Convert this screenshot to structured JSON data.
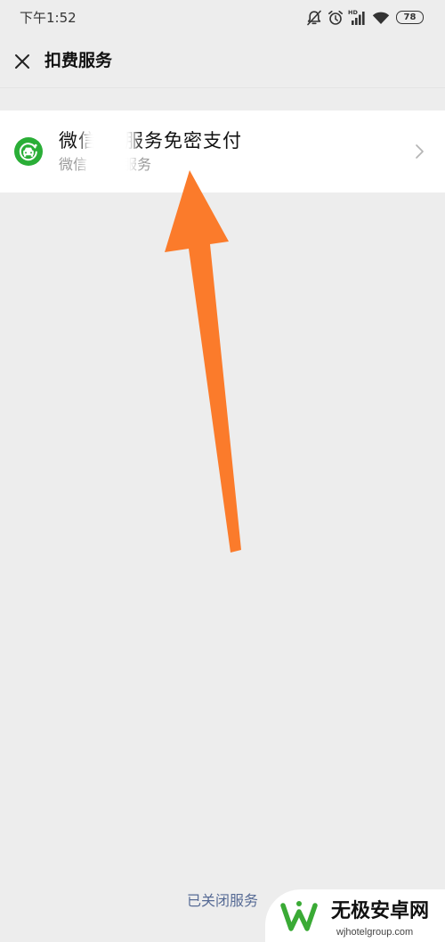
{
  "status_bar": {
    "time": "下午1:52",
    "hd_label": "HD",
    "battery": "78",
    "icons": [
      "mute-bell-icon",
      "alarm-clock-icon",
      "hd-signal-icon",
      "wifi-icon",
      "battery-icon"
    ]
  },
  "header": {
    "close_icon": "close-icon",
    "title": "扣费服务"
  },
  "service_list": [
    {
      "icon": "car-icon",
      "title_visible_start": "微信",
      "title_visible_end": "服务免密支付",
      "subtitle_visible_start": "微信",
      "subtitle_visible_end": "服务",
      "action_icon": "chevron-right-icon"
    }
  ],
  "footer": {
    "closed_services_link": "已关闭服务"
  },
  "watermark": {
    "logo_icon": "w-logo-icon",
    "site_name": "无极安卓网",
    "domain_text": "wjhotelgroup.com"
  },
  "colors": {
    "background": "#ededed",
    "card": "#ffffff",
    "service_icon": "#2aae37",
    "link": "#576b95",
    "annotation_arrow": "#fb7b2b",
    "watermark_logo": "#3aaa35"
  }
}
